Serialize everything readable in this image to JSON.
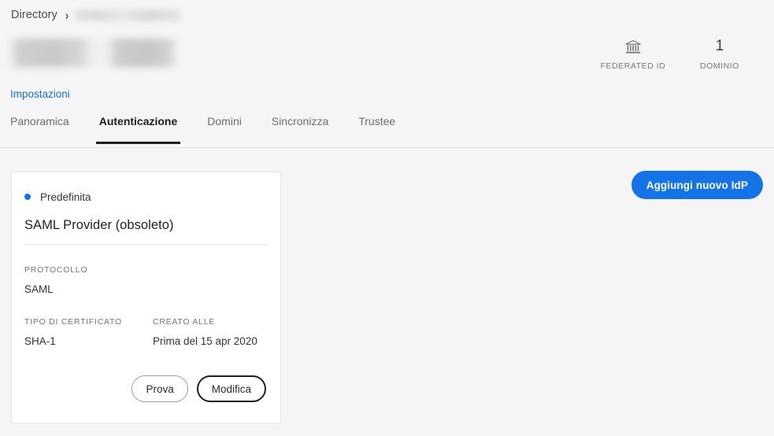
{
  "breadcrumb": {
    "root_label": "Directory",
    "separator_icon": "chevron-right-icon",
    "current_redacted": ""
  },
  "page_title_redacted": "",
  "stats": [
    {
      "icon": "bank-institution-icon",
      "value": "",
      "label": "FEDERATED ID"
    },
    {
      "icon": "",
      "value": "1",
      "label": "DOMINIO"
    }
  ],
  "settings_link": "Impostazioni",
  "tabs": [
    {
      "label": "Panoramica",
      "active": false
    },
    {
      "label": "Autenticazione",
      "active": true
    },
    {
      "label": "Domini",
      "active": false
    },
    {
      "label": "Sincronizza",
      "active": false
    },
    {
      "label": "Trustee",
      "active": false
    }
  ],
  "actions": {
    "add_idp_label": "Aggiungi nuovo IdP"
  },
  "idp_card": {
    "default_badge": "Predefinita",
    "name": "SAML Provider (obsoleto)",
    "fields": {
      "protocol_label": "PROTOCOLLO",
      "protocol_value": "SAML",
      "cert_type_label": "TIPO DI CERTIFICATO",
      "cert_type_value": "SHA-1",
      "created_label": "CREATO ALLE",
      "created_value": "Prima del 15 apr 2020"
    },
    "buttons": {
      "test_label": "Prova",
      "edit_label": "Modifica"
    }
  },
  "colors": {
    "accent_blue": "#1473e6",
    "link_blue": "#1a6fd4",
    "page_background": "#f5f5f5",
    "card_background": "#ffffff",
    "active_tab_underline": "#1f1f1f"
  }
}
